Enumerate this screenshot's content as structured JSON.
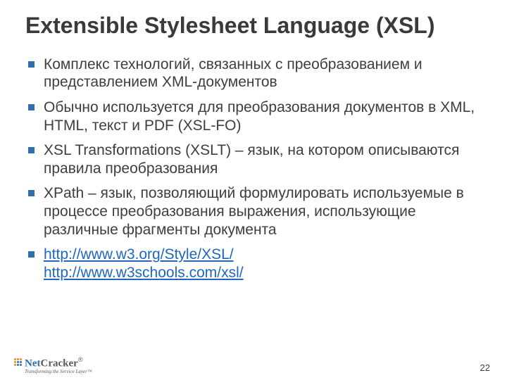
{
  "title": "Extensible Stylesheet Language (XSL)",
  "bullets": [
    {
      "text": "Комплекс технологий, связанных с преобразованием и представлением XML-документов"
    },
    {
      "text": "Обычно используется для преобразования документов в XML, HTML, текст и PDF (XSL-FO)"
    },
    {
      "text": "XSL Transformations (XSLT) – язык, на котором описываются правила преобразования"
    },
    {
      "text": "XPath – язык, позволяющий формулировать используемые в процессе преобразования выражения, использующие различные фрагменты документа"
    }
  ],
  "links": {
    "url1": "http://www.w3.org/Style/XSL/",
    "url2": "http://www.w3schools.com/xsl/"
  },
  "logo": {
    "net": "Net",
    "cracker": "Cracker",
    "reg": "®",
    "tagline": "Transforming the Service Layer™"
  },
  "pageNumber": "22"
}
